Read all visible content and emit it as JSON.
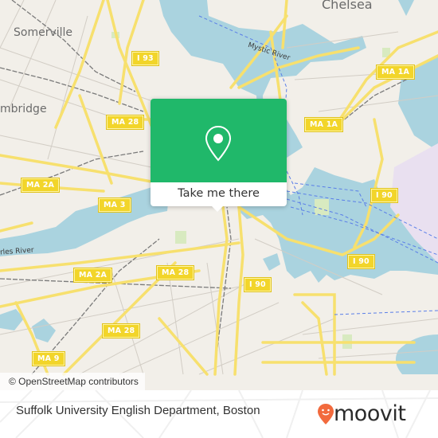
{
  "map": {
    "colors": {
      "land": "#f2efe9",
      "water": "#aad3df",
      "road_major": "#f7e06e",
      "road_minor": "#cfcac2",
      "rail": "#777777",
      "park": "#d8eac0",
      "airport": "#e6dcf0",
      "ferry": "#5a7ee8",
      "shield": "#f2d52a"
    },
    "place_labels": [
      {
        "id": "somerville",
        "text": "Somerville"
      },
      {
        "id": "cambridge",
        "text": "mbridge"
      },
      {
        "id": "chelsea",
        "text": "Chelsea"
      },
      {
        "id": "mystic-river",
        "text": "Mystic River"
      },
      {
        "id": "charles-river",
        "text": "rles River"
      }
    ],
    "route_shields": [
      {
        "id": "i93",
        "text": "I 93"
      },
      {
        "id": "ma28-north",
        "text": "MA 28"
      },
      {
        "id": "ma1a-north",
        "text": "MA 1A"
      },
      {
        "id": "ma1a-mid",
        "text": "MA 1A"
      },
      {
        "id": "ma2a-west",
        "text": "MA 2A"
      },
      {
        "id": "ma3",
        "text": "MA 3"
      },
      {
        "id": "i90-east",
        "text": "I 90"
      },
      {
        "id": "i90-harbor",
        "text": "I 90"
      },
      {
        "id": "ma2a-south",
        "text": "MA 2A"
      },
      {
        "id": "ma28-mid",
        "text": "MA 28"
      },
      {
        "id": "i90-south",
        "text": "I 90"
      },
      {
        "id": "ma28-south",
        "text": "MA 28"
      },
      {
        "id": "ma9",
        "text": "MA 9"
      }
    ],
    "attribution": "© OpenStreetMap contributors"
  },
  "popup": {
    "icon": "map-pin-icon",
    "button_label": "Take me there",
    "accent": "#20b86a"
  },
  "footer": {
    "place_name": "Suffolk University English Department, Boston",
    "brand": "moovit",
    "brand_color": "#f26a3d"
  }
}
